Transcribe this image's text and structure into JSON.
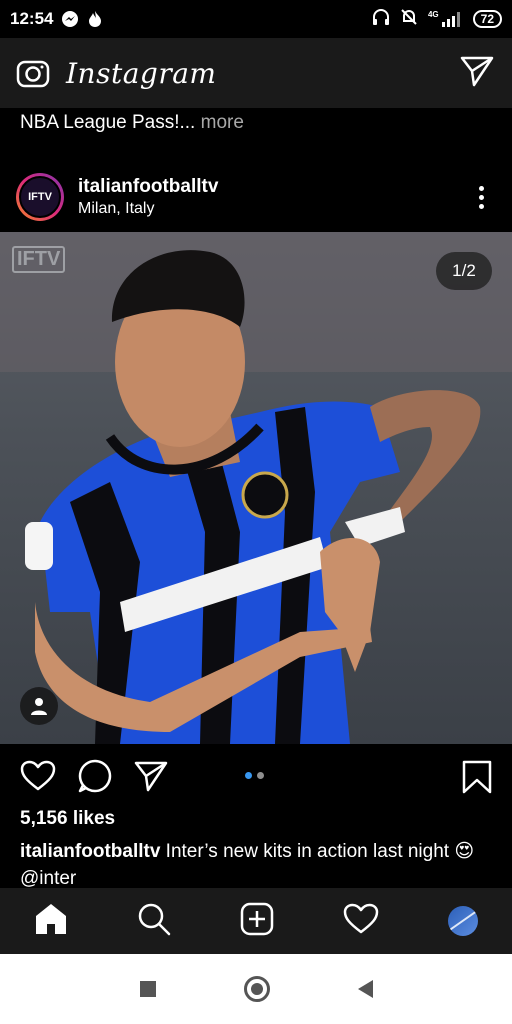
{
  "status_bar": {
    "time": "12:54",
    "network": "4G",
    "battery": "72",
    "icons": [
      "messenger-icon",
      "fire-icon",
      "headphones-icon",
      "mute-icon",
      "signal-icon",
      "battery-icon"
    ]
  },
  "app_bar": {
    "title": "Instagram",
    "icons": [
      "camera-icon",
      "direct-message-icon"
    ]
  },
  "previous_caption": {
    "text": "NBA League Pass!...",
    "more": " more"
  },
  "post": {
    "username": "italianfootballtv",
    "location": "Milan, Italy",
    "avatar_text": "IFTV",
    "watermark": "IFTV",
    "page_counter": "1/2",
    "likes": "5,156 likes",
    "caption_user": "italianfootballtv",
    "caption_text": " Inter’s new kits in action last night 😍",
    "caption_mention": "@inter",
    "carousel": {
      "current": 1,
      "total": 2
    },
    "colors": {
      "active_dot": "#3897f0",
      "inactive_dot": "#8e8e8e",
      "photo_jersey_blue": "#1d4fd8"
    }
  },
  "bottom_nav": {
    "items": [
      "home-icon",
      "search-icon",
      "add-post-icon",
      "activity-heart-icon",
      "profile-avatar"
    ]
  },
  "system_nav": {
    "items": [
      "recents-button",
      "home-button",
      "back-button"
    ]
  }
}
